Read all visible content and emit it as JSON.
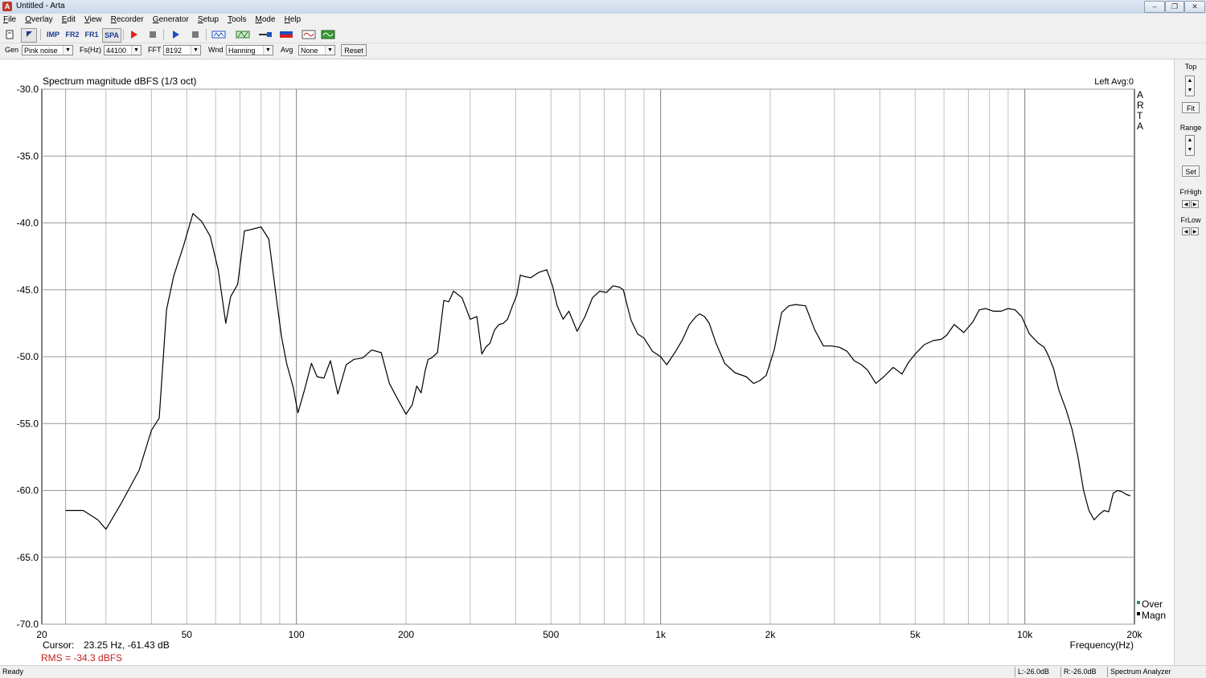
{
  "window": {
    "title": "Untitled - Arta",
    "app_icon": "arta-app-icon"
  },
  "menu": [
    {
      "label": "File",
      "ul": "F",
      "rest": "ile"
    },
    {
      "label": "Overlay",
      "ul": "O",
      "rest": "verlay"
    },
    {
      "label": "Edit",
      "ul": "E",
      "rest": "dit"
    },
    {
      "label": "View",
      "ul": "V",
      "rest": "iew"
    },
    {
      "label": "Recorder",
      "ul": "R",
      "rest": "ecorder"
    },
    {
      "label": "Generator",
      "ul": "G",
      "rest": "enerator"
    },
    {
      "label": "Setup",
      "ul": "S",
      "rest": "etup"
    },
    {
      "label": "Tools",
      "ul": "T",
      "rest": "ools"
    },
    {
      "label": "Mode",
      "ul": "M",
      "rest": "ode"
    },
    {
      "label": "Help",
      "ul": "H",
      "rest": "elp"
    }
  ],
  "toolbar": {
    "new_icon": "new-document-icon",
    "open_icon": "open-arrow-icon",
    "imp_label": "IMP",
    "fr2_label": "FR2",
    "fr1_label": "FR1",
    "spa_label": "SPA",
    "record_icon": "record-icon",
    "stop_icon": "stop-icon",
    "play_icon": "play-icon",
    "stop2_icon": "stop-icon",
    "rec_sig_icon": "signal-record-icon",
    "sig_icon": "signal-icon",
    "cable_icon": "cable-icon",
    "meter_icon": "meter-icon",
    "wave_icon": "waveform-icon",
    "scope_icon": "scope-icon",
    "colors": {
      "record": "#e02020",
      "play": "#1f4fbf",
      "stop": "#7a7a7a"
    }
  },
  "params": {
    "gen_label": "Gen",
    "gen_value": "Pink noise",
    "fs_label": "Fs(Hz)",
    "fs_value": "44100",
    "fft_label": "FFT",
    "fft_value": "8192",
    "wnd_label": "Wnd",
    "wnd_value": "Hanning",
    "avg_label": "Avg",
    "avg_value": "None",
    "reset_label": "Reset"
  },
  "plot": {
    "title": "Spectrum magnitude dBFS (1/3 oct)",
    "channel_info": "Left  Avg:0",
    "watermark": [
      "A",
      "R",
      "T",
      "A"
    ],
    "cursor_label": "Cursor:",
    "cursor_value": "23.25 Hz, -61.43 dB",
    "rms_text": "RMS =  -34.3 dBFS",
    "legend": [
      {
        "label": "Over",
        "color": "#2a8a6a"
      },
      {
        "label": "Magn",
        "color": "#000000"
      }
    ],
    "colors": {
      "curve": "#000000",
      "cursor": "#c8a030",
      "grid": "#c0c0c0",
      "rms": "#c02020"
    }
  },
  "right_panel": {
    "top_label": "Top",
    "fit_label": "Fit",
    "range_label": "Range",
    "set_label": "Set",
    "frhigh_label": "FrHigh",
    "frlow_label": "FrLow"
  },
  "status": {
    "ready": "Ready",
    "left_level": "L:-26.0dB",
    "right_level": "R:-26.0dB",
    "mode": "Spectrum Analyzer"
  },
  "chart_data": {
    "type": "line",
    "title": "Spectrum magnitude dBFS (1/3 oct)",
    "xlabel": "Frequency(Hz)",
    "ylabel": "",
    "xscale": "log",
    "xlim": [
      20,
      20000
    ],
    "ylim": [
      -70,
      -30
    ],
    "grid": true,
    "legend_position": "bottom-right",
    "xticks": [
      20,
      50,
      100,
      200,
      500,
      1000,
      2000,
      5000,
      10000,
      20000
    ],
    "xtick_labels": [
      "20",
      "50",
      "100",
      "200",
      "500",
      "1k",
      "2k",
      "5k",
      "10k",
      "20k"
    ],
    "yticks": [
      -30,
      -35,
      -40,
      -45,
      -50,
      -55,
      -60,
      -65,
      -70
    ],
    "ytick_labels": [
      "-30.0",
      "-35.0",
      "-40.0",
      "-45.0",
      "-50.0",
      "-55.0",
      "-60.0",
      "-65.0",
      "-70.0"
    ],
    "cursor_x": 23.25,
    "series": [
      {
        "name": "Magn",
        "x": [
          23.25,
          26,
          28.5,
          30,
          33,
          37,
          40,
          42,
          43,
          44,
          46,
          49,
          52,
          55,
          58,
          61,
          64,
          66,
          69,
          72,
          75,
          80,
          84,
          88,
          91,
          94,
          98,
          101,
          105,
          110,
          114,
          119,
          124,
          130,
          137,
          144,
          152,
          161,
          171,
          180,
          190,
          200,
          208,
          214,
          220,
          226,
          230,
          235,
          244,
          254,
          262,
          270,
          285,
          300,
          313,
          323,
          331,
          340,
          350,
          360,
          370,
          380,
          392,
          403,
          412,
          422,
          440,
          463,
          487,
          505,
          520,
          540,
          560,
          590,
          620,
          650,
          680,
          710,
          740,
          770,
          790,
          810,
          830,
          865,
          900,
          950,
          1000,
          1040,
          1100,
          1150,
          1200,
          1250,
          1280,
          1320,
          1360,
          1420,
          1500,
          1600,
          1720,
          1800,
          1870,
          1950,
          2050,
          2150,
          2250,
          2350,
          2500,
          2650,
          2800,
          2950,
          3100,
          3250,
          3400,
          3560,
          3700,
          3900,
          4100,
          4350,
          4600,
          4800,
          5000,
          5300,
          5600,
          5900,
          6100,
          6400,
          6800,
          7200,
          7500,
          7800,
          8200,
          8600,
          9000,
          9400,
          9800,
          10300,
          10900,
          11300,
          11600,
          12000,
          12400,
          13000,
          13500,
          14000,
          14500,
          15000,
          15500,
          16000,
          16500,
          17000,
          17500,
          18000,
          18500,
          19000,
          19500
        ],
        "y": [
          -61.5,
          -61.5,
          -62.2,
          -62.9,
          -61.0,
          -58.5,
          -55.5,
          -54.6,
          -50.5,
          -46.5,
          -44.0,
          -41.7,
          -39.3,
          -39.9,
          -41.0,
          -43.5,
          -47.5,
          -45.5,
          -44.6,
          -40.6,
          -40.5,
          -40.3,
          -41.2,
          -45.5,
          -48.5,
          -50.5,
          -52.3,
          -54.2,
          -52.6,
          -50.5,
          -51.5,
          -51.6,
          -50.3,
          -52.8,
          -50.6,
          -50.2,
          -50.1,
          -49.5,
          -49.7,
          -52.0,
          -53.2,
          -54.3,
          -53.6,
          -52.2,
          -52.7,
          -51.0,
          -50.2,
          -50.1,
          -49.7,
          -45.8,
          -45.9,
          -45.1,
          -45.6,
          -47.2,
          -47.0,
          -49.8,
          -49.3,
          -49.0,
          -48.0,
          -47.6,
          -47.5,
          -47.2,
          -46.2,
          -45.4,
          -43.9,
          -44.0,
          -44.1,
          -43.7,
          -43.5,
          -44.7,
          -46.2,
          -47.2,
          -46.6,
          -48.1,
          -47.0,
          -45.6,
          -45.1,
          -45.2,
          -44.7,
          -44.8,
          -45.0,
          -46.2,
          -47.3,
          -48.3,
          -48.6,
          -49.6,
          -50.0,
          -50.6,
          -49.6,
          -48.7,
          -47.6,
          -47.0,
          -46.8,
          -47.0,
          -47.5,
          -49.0,
          -50.5,
          -51.2,
          -51.5,
          -52.0,
          -51.8,
          -51.4,
          -49.5,
          -46.7,
          -46.2,
          -46.1,
          -46.2,
          -48.0,
          -49.2,
          -49.2,
          -49.3,
          -49.6,
          -50.3,
          -50.6,
          -51.0,
          -52.0,
          -51.5,
          -50.8,
          -51.3,
          -50.4,
          -49.8,
          -49.1,
          -48.8,
          -48.7,
          -48.4,
          -47.6,
          -48.2,
          -47.4,
          -46.5,
          -46.4,
          -46.6,
          -46.6,
          -46.4,
          -46.5,
          -47.0,
          -48.3,
          -49.0,
          -49.3,
          -49.9,
          -50.9,
          -52.5,
          -54.0,
          -55.5,
          -57.5,
          -60.0,
          -61.5,
          -62.2,
          -61.8,
          -61.5,
          -61.6,
          -60.2,
          -60.0,
          -60.1,
          -60.3,
          -60.4
        ]
      }
    ]
  }
}
